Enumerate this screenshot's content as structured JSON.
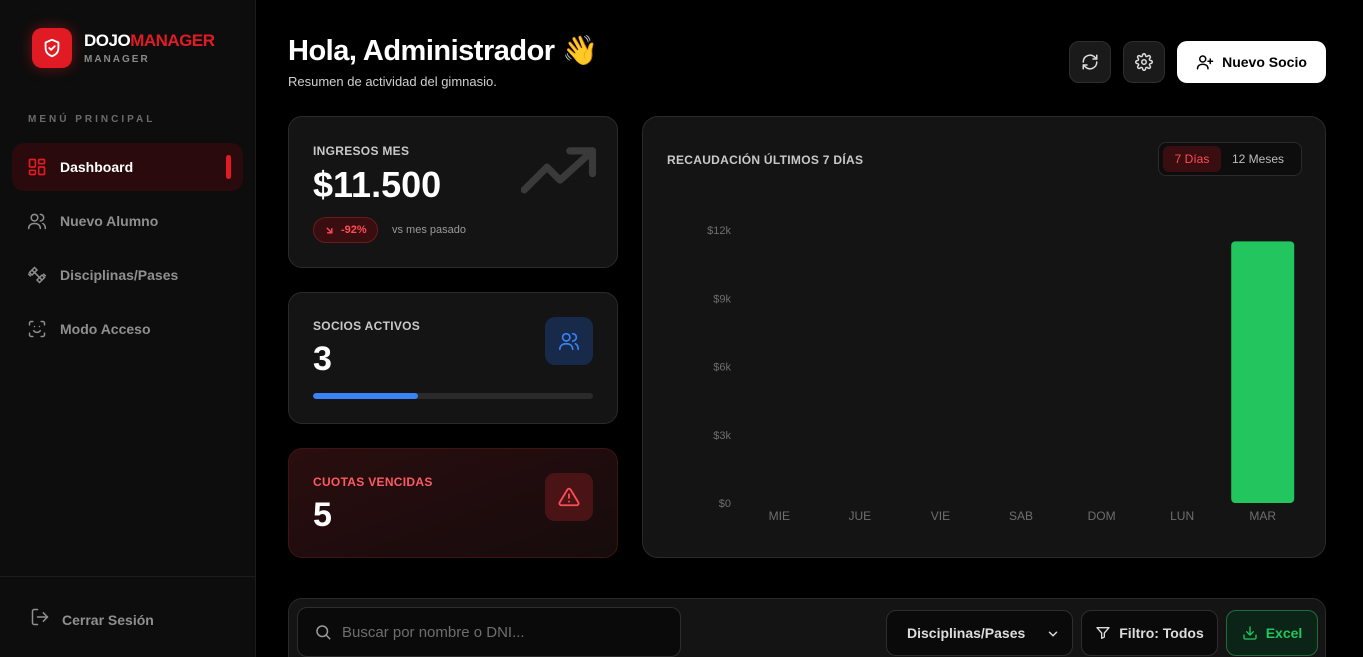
{
  "brand": {
    "name_white": "DOJO",
    "name_red": "MANAGER",
    "subtitle": "MANAGER"
  },
  "sidebar": {
    "menu_title": "MENÚ PRINCIPAL",
    "items": [
      {
        "label": "Dashboard",
        "icon": "dashboard-grid-icon",
        "active": true
      },
      {
        "label": "Nuevo Alumno",
        "icon": "users-icon",
        "active": false
      },
      {
        "label": "Disciplinas/Pases",
        "icon": "dumbbell-icon",
        "active": false
      },
      {
        "label": "Modo Acceso",
        "icon": "face-scan-icon",
        "active": false
      }
    ],
    "logout_label": "Cerrar Sesión"
  },
  "header": {
    "title": "Hola, Administrador 👋",
    "subtitle": "Resumen de actividad del gimnasio.",
    "refresh_icon": "refresh-icon",
    "settings_icon": "gear-icon",
    "new_member_label": "Nuevo Socio"
  },
  "cards": {
    "income": {
      "title": "INGRESOS MES",
      "value": "$11.500",
      "change": "-92%",
      "change_note": "vs mes pasado",
      "icon": "trending-up-icon"
    },
    "active_members": {
      "title": "SOCIOS ACTIVOS",
      "value": "3",
      "icon": "users-icon",
      "progress": 0.375
    },
    "overdue": {
      "title": "CUOTAS VENCIDAS",
      "value": "5",
      "icon": "warning-triangle-icon"
    }
  },
  "chart_panel": {
    "title": "RECAUDACIÓN ÚLTIMOS 7 DÍAS",
    "range_options": [
      {
        "label": "7 Días",
        "selected": true
      },
      {
        "label": "12 Meses",
        "selected": false
      }
    ]
  },
  "chart_data": {
    "type": "bar",
    "categories": [
      "MIE",
      "JUE",
      "VIE",
      "SAB",
      "DOM",
      "LUN",
      "MAR"
    ],
    "values": [
      0,
      0,
      0,
      0,
      0,
      0,
      11500
    ],
    "yticks": [
      "$0",
      "$3k",
      "$6k",
      "$9k",
      "$12k"
    ],
    "ytick_values": [
      0,
      3000,
      6000,
      9000,
      12000
    ],
    "ylim": [
      0,
      12000
    ],
    "bar_color": "#22c55e",
    "grid": false
  },
  "filters": {
    "search_placeholder": "Buscar por nombre o DNI...",
    "discipline_select": "Disciplinas/Pases",
    "filter_label": "Filtro: Todos",
    "excel_label": "Excel"
  },
  "colors": {
    "accent": "#e01b24",
    "success": "#22c55e",
    "info": "#3b82f6"
  }
}
